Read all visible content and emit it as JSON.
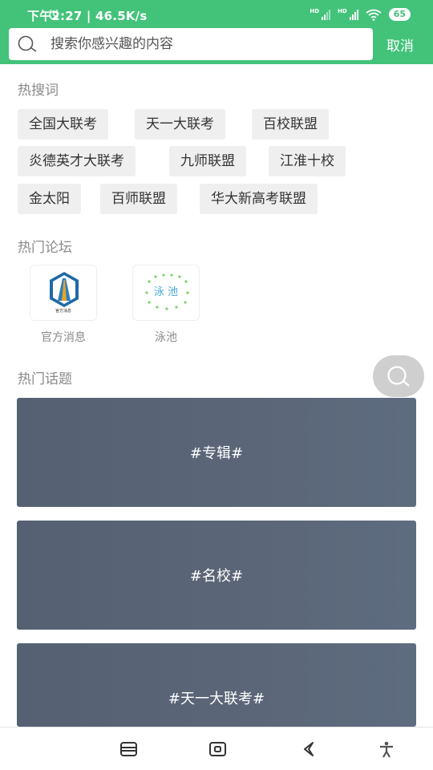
{
  "status_bar": {
    "time_speed": "下午2:27 | 46.5K/s",
    "signal_badge": "HD",
    "battery": "65"
  },
  "search": {
    "placeholder": "搜索你感兴趣的内容",
    "value": "",
    "cancel_label": "取消"
  },
  "hot_search": {
    "title": "热搜词",
    "tags": [
      "全国大联考",
      "天一大联考",
      "百校联盟",
      "炎德英才大联考",
      "九师联盟",
      "江淮十校",
      "金太阳",
      "百师联盟",
      "华大新高考联盟"
    ]
  },
  "hot_forums": {
    "title": "热门论坛",
    "items": [
      {
        "name": "官方消息",
        "logo_caption": "官方消息"
      },
      {
        "name": "泳池",
        "logo_text": "泳 池"
      }
    ]
  },
  "hot_topics": {
    "title": "热门话题",
    "items": [
      "#专辑#",
      "#名校#",
      "#天一大联考#"
    ]
  },
  "colors": {
    "brand_green": "#43c37a",
    "tag_bg": "#efefef",
    "card_bg": "#586476"
  },
  "icons": {
    "search": "search-icon",
    "fab": "search-icon",
    "nav_menu": "menu-icon",
    "nav_home": "home-icon",
    "nav_back": "back-icon",
    "nav_accessibility": "accessibility-icon"
  }
}
